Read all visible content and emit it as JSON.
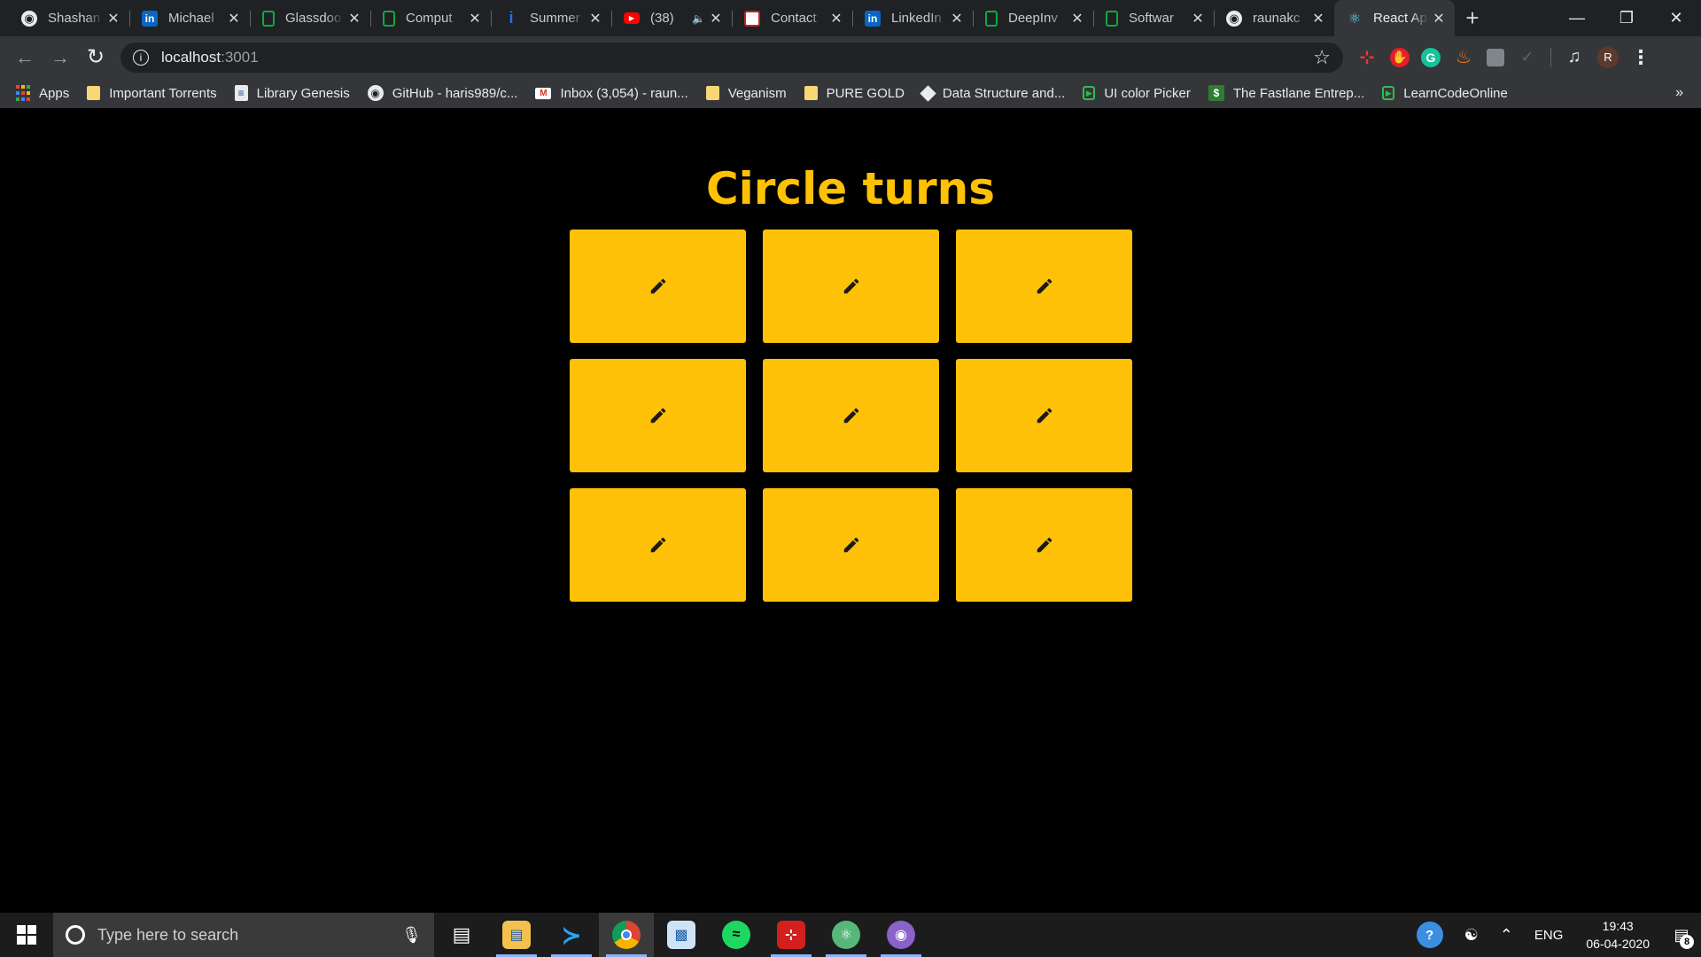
{
  "browser": {
    "tabs": [
      {
        "title": "Shashan",
        "favicon": "github-icon",
        "active": false
      },
      {
        "title": "Michael",
        "favicon": "linkedin-icon",
        "active": false
      },
      {
        "title": "Glassdoo",
        "favicon": "glassdoor-icon",
        "active": false
      },
      {
        "title": "Comput",
        "favicon": "glassdoor-icon",
        "active": false
      },
      {
        "title": "Summer",
        "favicon": "info-icon",
        "active": false
      },
      {
        "title": "(38)",
        "favicon": "youtube-icon",
        "active": false,
        "audio": true
      },
      {
        "title": "Contact",
        "favicon": "contact-icon",
        "active": false
      },
      {
        "title": "LinkedIn",
        "favicon": "linkedin-icon",
        "active": false
      },
      {
        "title": "DeepInv",
        "favicon": "glassdoor-icon",
        "active": false
      },
      {
        "title": "Softwar",
        "favicon": "glassdoor-icon",
        "active": false
      },
      {
        "title": "raunakc",
        "favicon": "github-icon",
        "active": false
      },
      {
        "title": "React Ap",
        "favicon": "react-icon",
        "active": true
      }
    ],
    "address": {
      "host": "localhost",
      "port": ":3001"
    },
    "profile_initial": "R",
    "bookmarks": [
      {
        "label": "Apps",
        "icon": "apps-grid-icon"
      },
      {
        "label": "Important Torrents",
        "icon": "folder-icon"
      },
      {
        "label": "Library Genesis",
        "icon": "book-icon"
      },
      {
        "label": "GitHub - haris989/c...",
        "icon": "github-icon"
      },
      {
        "label": "Inbox (3,054) - raun...",
        "icon": "gmail-icon"
      },
      {
        "label": "Veganism",
        "icon": "folder-icon"
      },
      {
        "label": "PURE GOLD",
        "icon": "folder-icon"
      },
      {
        "label": "Data Structure and...",
        "icon": "ds-icon"
      },
      {
        "label": "UI color Picker",
        "icon": "play-icon"
      },
      {
        "label": "The Fastlane Entrep...",
        "icon": "dollar-icon"
      },
      {
        "label": "LearnCodeOnline",
        "icon": "play-icon"
      }
    ],
    "bookmarks_more": "»"
  },
  "page": {
    "title": "Circle turns",
    "board": {
      "cells": [
        {
          "icon": "pencil-icon"
        },
        {
          "icon": "pencil-icon"
        },
        {
          "icon": "pencil-icon"
        },
        {
          "icon": "pencil-icon"
        },
        {
          "icon": "pencil-icon"
        },
        {
          "icon": "pencil-icon"
        },
        {
          "icon": "pencil-icon"
        },
        {
          "icon": "pencil-icon"
        },
        {
          "icon": "pencil-icon"
        }
      ]
    },
    "colors": {
      "accent": "#ffc107",
      "background": "#000000"
    }
  },
  "taskbar": {
    "search_placeholder": "Type here to search",
    "language": "ENG",
    "time": "19:43",
    "date": "06-04-2020",
    "notification_count": "8"
  }
}
